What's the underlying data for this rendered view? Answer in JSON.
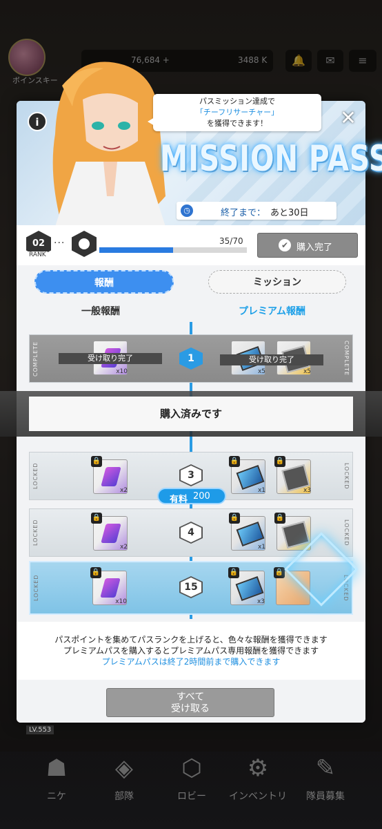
{
  "background": {
    "player_name": "ボインスキー",
    "currency1": "76,684 +",
    "currency2": "3488 K",
    "level_label": "LV.553"
  },
  "banner": {
    "title": "MISSION PASS",
    "speech_line1": "パスミッション達成で",
    "speech_highlight": "「チーフリサーチャー」",
    "speech_line3": "を獲得できます！",
    "timer_label": "終了まで：",
    "timer_value": "あと30日"
  },
  "rank": {
    "current": "02",
    "rank_label": "RANK",
    "dots": "···",
    "progress_text": "35/70",
    "progress_fraction": 0.5,
    "purchase_status": "購入完了"
  },
  "tabs": {
    "rewards": "報酬",
    "missions": "ミッション"
  },
  "columns": {
    "normal": "一般報酬",
    "premium": "プレミアム報酬"
  },
  "rows": [
    {
      "level": "1",
      "status_left": "COMPLETE",
      "status_right": "COMPLETE",
      "claimed_label": "受け取り完了",
      "normal_qty": "x10",
      "premium_qty1": "x5",
      "premium_qty2": "x5"
    },
    {
      "level": "3",
      "status_left": "LOCKED",
      "status_right": "LOCKED",
      "normal_qty": "x2",
      "premium_qty1": "x1",
      "premium_qty2": "x3"
    },
    {
      "level": "4",
      "status_left": "LOCKED",
      "status_right": "LOCKED",
      "normal_qty": "x2",
      "premium_qty1": "x1",
      "premium_qty2": ""
    },
    {
      "level": "15",
      "status_left": "LOCKED",
      "status_right": "LOCKED",
      "normal_qty": "x10",
      "premium_qty1": "x3",
      "premium_qty2": ""
    }
  ],
  "purchased_banner": "購入済みです",
  "paid_badge": {
    "label": "有料",
    "value": "200"
  },
  "notes": {
    "line1": "パスポイントを集めてパスランクを上げると、色々な報酬を獲得できます",
    "line2": "プレミアムパスを購入するとプレミアムパス専用報酬を獲得できます",
    "line3": "プレミアムパスは終了2時間前まで購入できます"
  },
  "claim_all": {
    "line1": "すべて",
    "line2": "受け取る"
  },
  "bottom_nav": [
    "ニケ",
    "部隊",
    "ロビー",
    "インベントリ",
    "隊員募集"
  ],
  "colors": {
    "accent": "#2a9be4",
    "tab_active": "#3d8ff0",
    "premium_text": "#1ea0e8"
  }
}
